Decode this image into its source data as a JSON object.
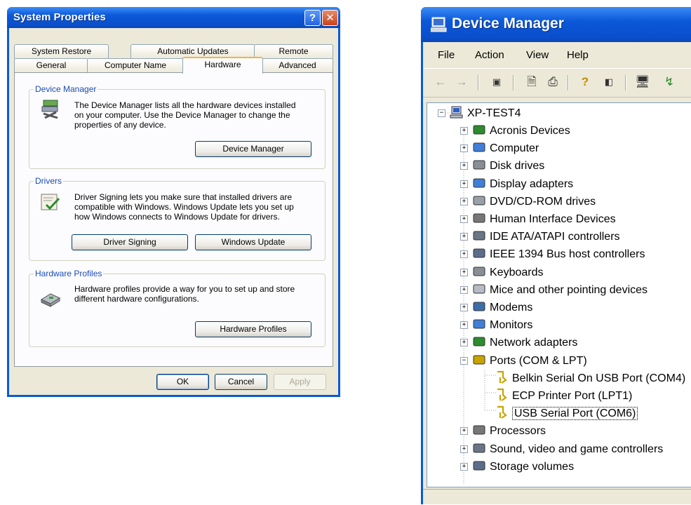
{
  "system_properties": {
    "title": "System Properties",
    "help_glyph": "?",
    "close_glyph": "✕",
    "tabs_back": [
      "System Restore",
      "Automatic Updates",
      "Remote"
    ],
    "tabs_front": [
      "General",
      "Computer Name",
      "Hardware",
      "Advanced"
    ],
    "active_tab": "Hardware",
    "groups": {
      "device_manager": {
        "legend": "Device Manager",
        "desc_lines": [
          "The Device Manager lists all the hardware devices installed",
          "on your computer. Use the Device Manager to change the",
          "properties of any device."
        ],
        "button": "Device Manager"
      },
      "drivers": {
        "legend": "Drivers",
        "desc_lines": [
          "Driver Signing lets you make sure that installed drivers are",
          "compatible with Windows. Windows Update lets you set up",
          "how Windows connects to Windows Update for drivers."
        ],
        "button_signing": "Driver Signing",
        "button_update": "Windows Update"
      },
      "hardware_profiles": {
        "legend": "Hardware Profiles",
        "desc_lines": [
          "Hardware profiles provide a way for you to set up and store",
          "different hardware configurations."
        ],
        "button": "Hardware Profiles"
      }
    },
    "footer": {
      "ok": "OK",
      "cancel": "Cancel",
      "apply": "Apply"
    }
  },
  "device_manager": {
    "title": "Device Manager",
    "menu": [
      "File",
      "Action",
      "View",
      "Help"
    ],
    "toolbar_icons": [
      "back-icon",
      "forward-icon",
      "console-tree-icon",
      "properties-icon",
      "print-icon",
      "help-icon",
      "details-icon",
      "scan-hardware-icon",
      "more-icon"
    ],
    "root": "XP-TEST4",
    "categories": [
      "Acronis Devices",
      "Computer",
      "Disk drives",
      "Display adapters",
      "DVD/CD-ROM drives",
      "Human Interface Devices",
      "IDE ATA/ATAPI controllers",
      "IEEE 1394 Bus host controllers",
      "Keyboards",
      "Mice and other pointing devices",
      "Modems",
      "Monitors",
      "Network adapters",
      "Ports (COM & LPT)"
    ],
    "ports_children": [
      "Belkin Serial On USB Port (COM4)",
      "ECP Printer Port (LPT1)",
      "USB Serial Port (COM6)"
    ],
    "selected_child": "USB Serial Port (COM6)",
    "categories_after": [
      "Processors",
      "Sound, video and game controllers",
      "Storage volumes"
    ],
    "colors": {
      "titlebar": "#0a5ad6",
      "face": "#ece9d8"
    }
  }
}
